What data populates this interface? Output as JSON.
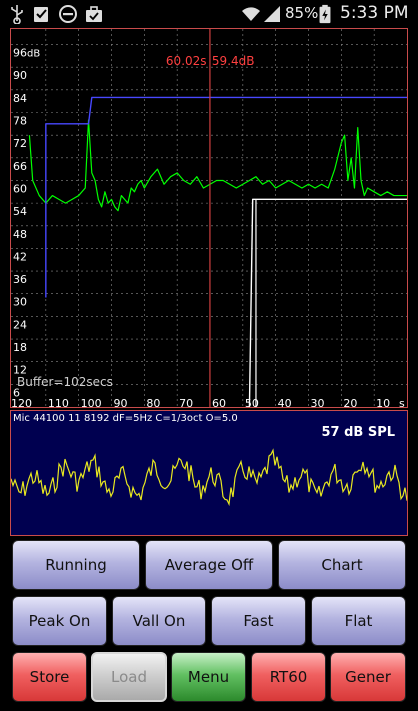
{
  "status_bar": {
    "icons": [
      "usb-icon",
      "checklist-icon",
      "do-not-disturb-icon",
      "briefcase-icon",
      "wifi-icon",
      "signal-icon",
      "battery-charging-icon"
    ],
    "battery": "85%",
    "time": "5:33 PM"
  },
  "spectrum_chart": {
    "unit": "dB",
    "y_ticks": [
      "96",
      "90",
      "84",
      "78",
      "72",
      "66",
      "60",
      "54",
      "48",
      "42",
      "36",
      "30",
      "24",
      "18",
      "12",
      "6"
    ],
    "x_ticks": [
      "120",
      "110",
      "100",
      "90",
      "80",
      "70",
      "60",
      "50",
      "40",
      "30",
      "20",
      "10",
      "s"
    ],
    "cursor_readout": "60.02s",
    "cursor_db": "59.4dB",
    "buffer_label": "Buffer=102secs"
  },
  "chart_data": {
    "type": "line",
    "title": "",
    "xlabel": "",
    "ylabel": "dB",
    "xlim": [
      120,
      0
    ],
    "ylim": [
      0,
      98
    ],
    "cursor": {
      "x": 60.02,
      "y": 59.4
    },
    "series": [
      {
        "color": "#00ff00",
        "x": [
          115,
          114,
          112,
          110,
          108,
          106,
          104,
          102,
          100,
          98,
          97,
          96,
          95,
          94,
          93,
          92,
          91,
          90,
          89,
          88,
          87,
          86,
          85,
          84,
          83,
          82,
          81,
          80,
          78,
          76,
          74,
          72,
          70,
          68,
          66,
          64,
          62,
          60,
          58,
          56,
          54,
          52,
          50,
          48,
          46,
          44,
          42,
          40,
          38,
          36,
          34,
          32,
          30,
          28,
          26,
          24,
          22,
          20,
          19,
          18,
          17,
          16,
          15,
          14,
          13,
          12,
          10,
          8,
          6,
          4,
          2,
          0
        ],
        "y": [
          72,
          60,
          56,
          54,
          56,
          55,
          54,
          55,
          56,
          58,
          76,
          62,
          60,
          55,
          53,
          57,
          54,
          55,
          53,
          52,
          56,
          55,
          54,
          58,
          57,
          59,
          60,
          58,
          61,
          63,
          59,
          61,
          62,
          60,
          59,
          61,
          58,
          59,
          60,
          60,
          59,
          58,
          59,
          60,
          61,
          59,
          60,
          58,
          59,
          60,
          59,
          58,
          59,
          58,
          59,
          58,
          63,
          70,
          72,
          60,
          66,
          58,
          74,
          60,
          56,
          58,
          57,
          56,
          57,
          56,
          56,
          56
        ]
      },
      {
        "color": "#4848ff",
        "x": [
          110,
          110,
          109,
          108,
          106,
          104,
          102,
          100,
          98,
          97,
          96,
          90,
          88,
          80,
          60,
          58,
          50,
          40,
          30,
          20,
          10,
          0
        ],
        "y": [
          29,
          75,
          75,
          75,
          75,
          75,
          75,
          75,
          75,
          75,
          82,
          82,
          82,
          82,
          82,
          82,
          82,
          82,
          82,
          82,
          82,
          82
        ]
      },
      {
        "color": "#ffffff",
        "x": [
          48,
          47,
          44,
          40,
          30,
          20,
          10,
          4,
          0
        ],
        "y": [
          0,
          55,
          55,
          55,
          55,
          55,
          55,
          55,
          55
        ]
      }
    ]
  },
  "waveform": {
    "info": "Mic 44100 11 8192 dF=5Hz C=1/3oct O=5.0",
    "spl": "57 dB SPL"
  },
  "buttons": {
    "row1": [
      "Running",
      "Average Off",
      "Chart"
    ],
    "row2": [
      "Peak On",
      "Vall On",
      "Fast",
      "Flat"
    ],
    "row3": [
      "Store",
      "Load",
      "Menu",
      "RT60",
      "Gener"
    ]
  }
}
